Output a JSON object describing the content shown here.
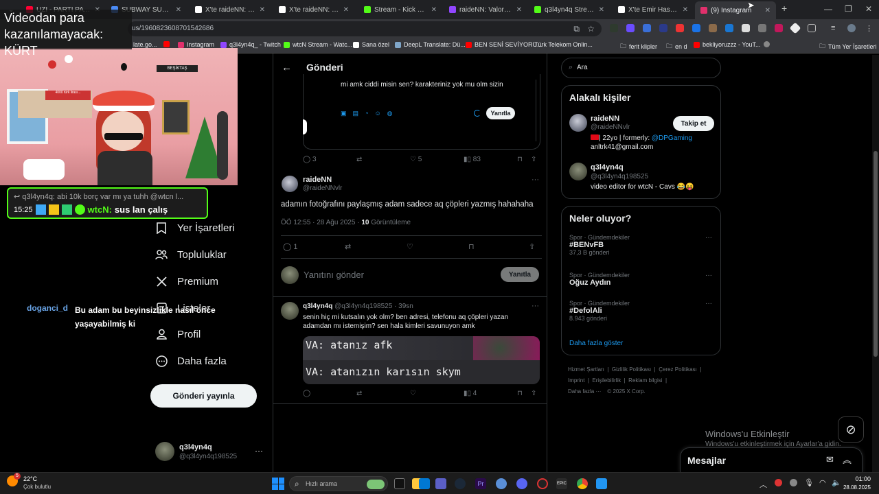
{
  "browser": {
    "tabs": [
      {
        "label": "UZI - PARTI PATLAR",
        "color": "#ff0033"
      },
      {
        "label": "SUBWAY SURFERS",
        "color": "#4b8bf5"
      },
      {
        "label": "X'te raideNN: \"@q3l4",
        "color": "#ffffff"
      },
      {
        "label": "X'te raideNN: \"@q3l4",
        "color": "#ffffff"
      },
      {
        "label": "Stream - Kick Dashbo",
        "color": "#53fc18"
      },
      {
        "label": "raideNN: Valorant Pl",
        "color": "#9146ff"
      },
      {
        "label": "q3l4yn4q Stream - W",
        "color": "#53fc18"
      },
      {
        "label": "X'te Emir Haspolat: \"",
        "color": "#ffffff"
      },
      {
        "label": "(9) Instagram",
        "color": "#e1306c"
      }
    ],
    "active_tab_index": 8,
    "url": "us/1960823608701542686",
    "bookmarks": [
      {
        "label": "late.go...",
        "color": "#4285f4"
      },
      {
        "label": "Instagram",
        "color": "#e1306c"
      },
      {
        "label": "q3l4yn4q_ - Twitch",
        "color": "#9146ff"
      },
      {
        "label": "wtcN Stream - Watc...",
        "color": "#53fc18"
      },
      {
        "label": "Sana özel",
        "color": "#ffffff"
      },
      {
        "label": "DeepL Translate: Dü...",
        "color": "#0f2b46"
      },
      {
        "label": "BEN SENİ SEVİYORU...",
        "color": "#ff0000"
      },
      {
        "label": "Türk Telekom Onlin...",
        "color": "#2e6ad1"
      },
      {
        "label": "ferit klipler",
        "color": "#c0c0c0"
      },
      {
        "label": "en d",
        "color": "#ff0000"
      },
      {
        "label": "bekliyoruzzz - YouT...",
        "color": "#ff0000"
      }
    ],
    "all_bookmarks": "Tüm Yer İşaretleri"
  },
  "stream_overlay": {
    "donation_title": "Videodan para kazanılamayacak: KÜRT",
    "reply_line": "q3l4yn4q: abi 10k borç var mı ya tuhh @wtcn l...",
    "chat_time": "15:25",
    "chat_user": "wtcN:",
    "chat_message": "sus lan çalış",
    "side_user": "doganci_d",
    "side_message": "Bu adam bu beyinsizlikle nasıl önce yaşayabilmiş ki",
    "banner": "BEŞİKTAŞ",
    "sign": "4000 türk lirası..."
  },
  "sidebar_nav": {
    "items": [
      {
        "label": "Yer İşaretleri",
        "icon": "bookmark-icon"
      },
      {
        "label": "Topluluklar",
        "icon": "communities-icon"
      },
      {
        "label": "Premium",
        "icon": "x-logo-icon"
      },
      {
        "label": "Listeler",
        "icon": "list-icon"
      },
      {
        "label": "Profil",
        "icon": "person-icon"
      },
      {
        "label": "Daha fazla",
        "icon": "more-circle-icon"
      }
    ],
    "post_button": "Gönderi yayınla",
    "account_name": "q3l4yn4q",
    "account_handle": "@q3l4yn4q198525"
  },
  "main": {
    "header_title": "Gönderi",
    "quoted_text": "mi amk ciddi misin sen? karakteriniz  yok mu olm sizin",
    "quoted_reply_button": "Yanıtla",
    "quoted_stats": {
      "replies": "3",
      "likes": "5",
      "views": "83"
    },
    "tweet": {
      "name": "raideNN",
      "handle": "@raideNNvlr",
      "text": "adamın fotoğrafını paylaşmış adam sadece aq çöpleri yazmış hahahaha",
      "time": "ÖÖ 12:55 · 28 Ağu 2025 · ",
      "views": "10",
      "views_label": " Görüntüleme",
      "replies": "1"
    },
    "reply_box": {
      "placeholder": "Yanıtını gönder",
      "button": "Yanıtla"
    },
    "reply": {
      "name": "q3l4yn4q",
      "handle": "@q3l4yn4q198525 · 39sn",
      "text": "senin hiç mi kutsalın yok olm? ben adresi, telefonu aq çöpleri yazan adamdan mı istemişim? sen hala kimleri savunuyon amk",
      "image_line1": "VA: atanız afk",
      "image_line2": "VA: atanızın karısın skym",
      "views": "4"
    }
  },
  "right": {
    "search_placeholder": "Ara",
    "related_title": "Alakalı kişiler",
    "people": [
      {
        "name": "raideNN",
        "handle": "@raideNNvlr",
        "bio_pre": "| 22yo | formerly: ",
        "bio_link": "@DPGaming",
        "bio_line2": "anltrk41@gmail.com",
        "follow": "Takip et"
      },
      {
        "name": "q3l4yn4q",
        "handle": "@q3l4yn4q198525",
        "bio_pre": "video editor for wtcN - Cavs 😂😝"
      }
    ],
    "trends_title": "Neler oluyor?",
    "trends": [
      {
        "category": "Spor · Gündemdekiler",
        "name": "#BENvFB",
        "count": "37,3 B gönderi"
      },
      {
        "category": "Spor · Gündemdekiler",
        "name": "Oğuz Aydın",
        "count": ""
      },
      {
        "category": "Spor · Gündemdekiler",
        "name": "#DefolAli",
        "count": "8.943 gönderi"
      }
    ],
    "show_more": "Daha fazla göster",
    "footer": [
      "Hizmet Şartları",
      "Gizlilik Politikası",
      "Çerez Politikası",
      "Imprint",
      "Erişilebilirlik",
      "Reklam bilgisi",
      "Daha fazla ···",
      "© 2025 X Corp."
    ],
    "messages": "Mesajlar",
    "accent": "#1d9bf0"
  },
  "windows": {
    "activate_title": "Windows'u Etkinleştir",
    "activate_sub": "Windows'u etkinleştirmek için Ayarlar'a gidin.",
    "weather_temp": "22°C",
    "weather_desc": "Çok bulutlu",
    "weather_badge": "5",
    "search_placeholder": "Hızlı arama",
    "time": "01:00",
    "date": "28.08.2025"
  }
}
